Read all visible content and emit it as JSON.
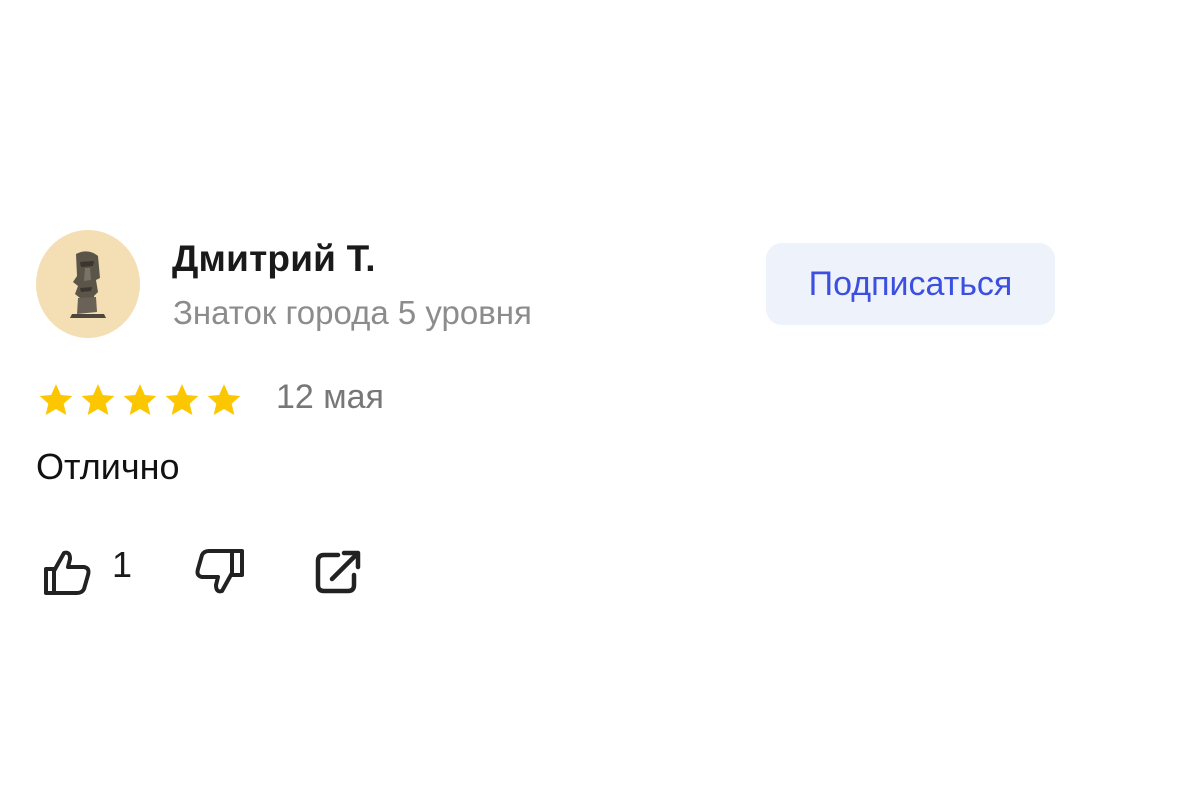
{
  "author": {
    "name": "Дмитрий Т.",
    "level": "Знаток города 5 уровня",
    "avatar_icon": "moai-statue-icon",
    "avatar_bg": "#f4dfb5"
  },
  "subscribe": {
    "label": "Подписаться",
    "bg": "#eef3fb",
    "color": "#3c4fe0"
  },
  "review": {
    "rating": 5,
    "rating_max": 5,
    "star_color": "#fcc600",
    "date": "12 мая",
    "text": "Отлично"
  },
  "actions": {
    "like_icon": "thumbs-up-icon",
    "like_count": "1",
    "dislike_icon": "thumbs-down-icon",
    "share_icon": "share-icon"
  }
}
